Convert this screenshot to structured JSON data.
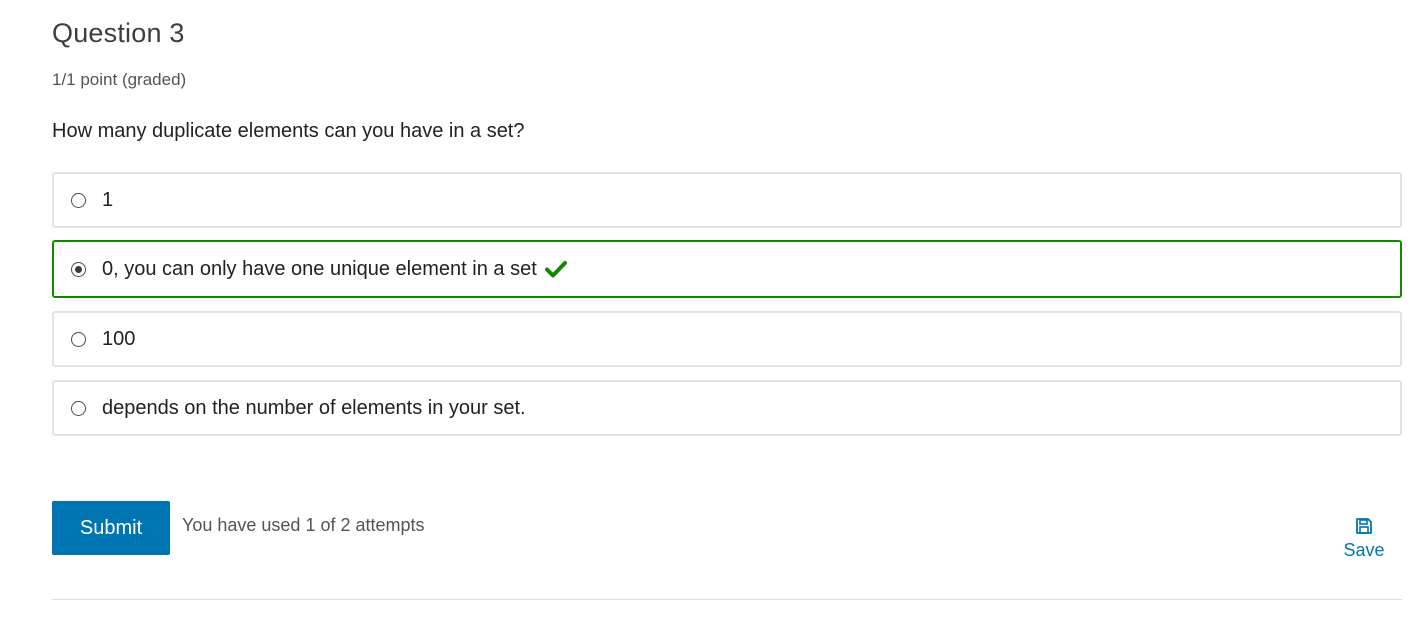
{
  "problem": {
    "title": "Question 3",
    "points": "1/1 point (graded)",
    "prompt": "How many duplicate elements can you have in a set?"
  },
  "options": [
    {
      "label": "1",
      "selected": false,
      "correct": false
    },
    {
      "label": "0, you can only have one unique element in a set",
      "selected": true,
      "correct": true
    },
    {
      "label": "100",
      "selected": false,
      "correct": false
    },
    {
      "label": "depends on the number of elements in your set.",
      "selected": false,
      "correct": false
    }
  ],
  "actions": {
    "submit_label": "Submit",
    "attempts_text": "You have used 1 of 2 attempts",
    "save_label": "Save"
  },
  "icons": {
    "correct": "check-icon",
    "save": "floppy-disk-icon"
  },
  "colors": {
    "accent": "#0075b4",
    "correct": "#118800",
    "option_border": "#e3e3e3"
  }
}
